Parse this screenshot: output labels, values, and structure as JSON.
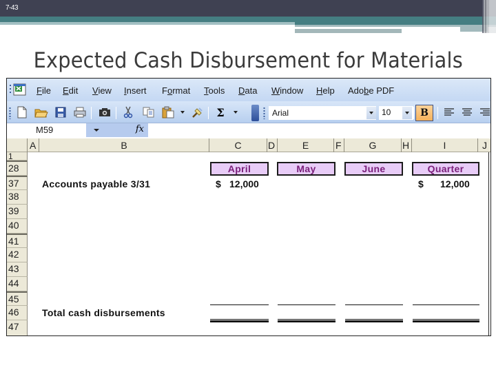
{
  "slide": {
    "number": "7-43",
    "title": "Expected Cash Disbursement for Materials"
  },
  "excel": {
    "menu": [
      "File",
      "Edit",
      "View",
      "Insert",
      "Format",
      "Tools",
      "Data",
      "Window",
      "Help",
      "Adobe PDF"
    ],
    "toolbar": {
      "icons": [
        "new-icon",
        "open-icon",
        "save-icon",
        "print-icon",
        "camera-icon",
        "cut-icon",
        "copy-icon",
        "paste-icon",
        "format-painter-icon",
        "autosum-icon"
      ],
      "autosum_glyph": "Σ",
      "font_name": "Arial",
      "font_size": "10",
      "bold_label": "B"
    },
    "formula_bar": {
      "name_box": "M59",
      "fx_label": "fx",
      "formula": ""
    },
    "columns": [
      "A",
      "B",
      "C",
      "D",
      "E",
      "F",
      "G",
      "H",
      "I",
      "J"
    ],
    "rows": [
      "1",
      "28",
      "37",
      "38",
      "39",
      "40",
      "41",
      "42",
      "43",
      "44",
      "45",
      "46",
      "47"
    ],
    "headers": {
      "april": "April",
      "may": "May",
      "june": "June",
      "quarter": "Quarter"
    },
    "accounts_payable": {
      "label": "Accounts payable 3/31",
      "april_currency": "$",
      "april_value": "12,000",
      "quarter_currency": "$",
      "quarter_value": "12,000"
    },
    "total": {
      "label": "Total cash disbursements"
    }
  },
  "colors": {
    "header_fill": "#e8ccf7",
    "header_text": "#7a1f7a",
    "slide_bar": "#3f4152",
    "teal": "#457e82"
  }
}
